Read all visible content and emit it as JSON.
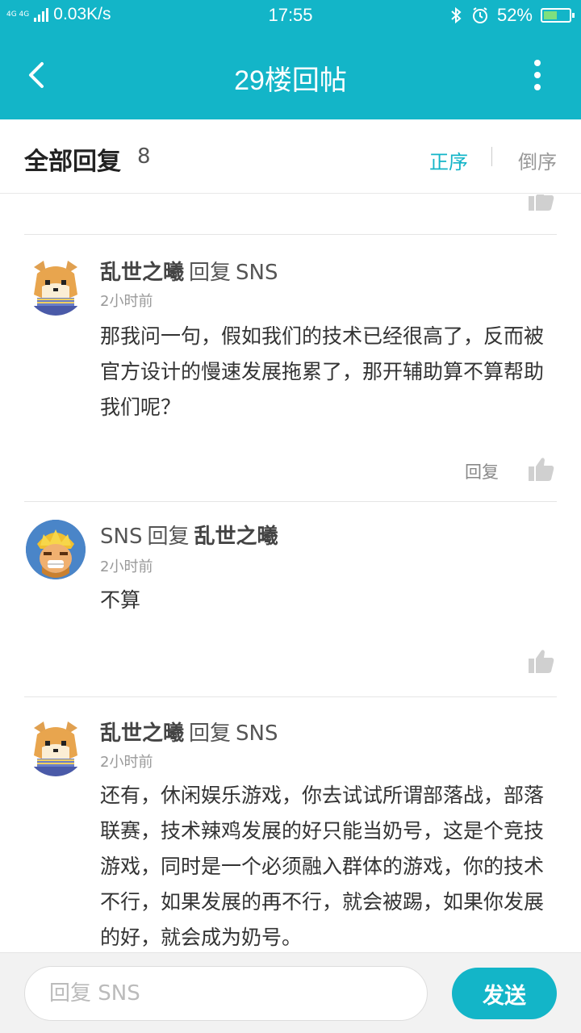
{
  "status_bar": {
    "network_badge": "4G 4G",
    "speed": "0.03K/s",
    "time": "17:55",
    "battery": "52%",
    "battery_level": 0.52,
    "icons": [
      "signal-icon",
      "bluetooth-icon",
      "alarm-icon",
      "battery-icon"
    ]
  },
  "app_bar": {
    "title": "29楼回帖",
    "back_icon": "back-arrow-icon",
    "more_icon": "more-vertical-icon"
  },
  "sort_bar": {
    "title": "全部回复",
    "count": "8",
    "asc_label": "正序",
    "desc_label": "倒序",
    "active": "asc"
  },
  "replies": [
    {
      "author": "乱世之曦",
      "verb": "回复",
      "target": "SNS",
      "time": "2小时前",
      "content": "那我问一句，假如我们的技术已经很高了，反而被官方设计的慢速发展拖累了，那开辅助算不算帮助我们呢？",
      "reply_label": "回复",
      "avatar": "shiba-dog-avatar"
    },
    {
      "author": "SNS",
      "verb": "回复",
      "target": "乱世之曦",
      "time": "2小时前",
      "content": "不算",
      "avatar": "barbarian-avatar"
    },
    {
      "author": "乱世之曦",
      "verb": "回复",
      "target": "SNS",
      "time": "2小时前",
      "content": "还有，休闲娱乐游戏，你去试试所谓部落战，部落联赛，技术辣鸡发展的好只能当奶号，这是个竞技游戏，同时是一个必须融入群体的游戏，你的技术不行，如果发展的再不行，就会被踢，如果你发展的好，就会成为奶号。",
      "avatar": "shiba-dog-avatar"
    }
  ],
  "input_bar": {
    "placeholder": "回复 SNS",
    "value": "",
    "send_label": "发送"
  },
  "colors": {
    "accent": "#13b5c8",
    "text_primary": "#333333",
    "text_secondary": "#999999",
    "divider": "#e5e5e5"
  }
}
